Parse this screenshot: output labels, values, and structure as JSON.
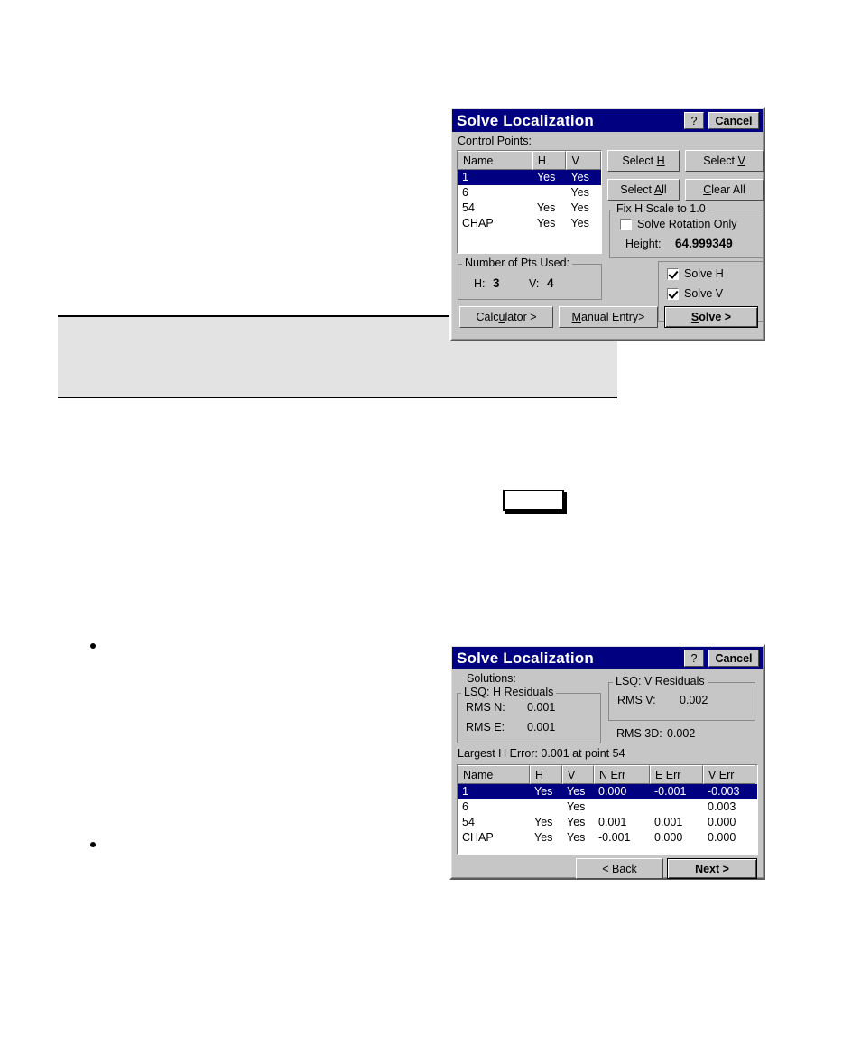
{
  "document": {
    "note_box": "",
    "empty_box": "",
    "bullets": [
      "",
      ""
    ]
  },
  "dialog_solve": {
    "title": "Solve Localization",
    "help_label": "?",
    "cancel_label": "Cancel",
    "control_points_label": "Control Points:",
    "table": {
      "columns": [
        "Name",
        "H",
        "V"
      ],
      "rows": [
        {
          "name": "1",
          "h": "Yes",
          "v": "Yes",
          "selected": true
        },
        {
          "name": "6",
          "h": "",
          "v": "Yes",
          "selected": false
        },
        {
          "name": "54",
          "h": "Yes",
          "v": "Yes",
          "selected": false
        },
        {
          "name": "CHAP",
          "h": "Yes",
          "v": "Yes",
          "selected": false
        }
      ]
    },
    "buttons": {
      "select_h": "Select H",
      "select_v": "Select V",
      "select_all": "Select All",
      "clear_all": "Clear All",
      "calculator": "Calculator >",
      "manual_entry": "Manual Entry>",
      "solve": "Solve >"
    },
    "fix_scale_group": {
      "label": "Fix H Scale to 1.0",
      "solve_rotation_only_label": "Solve Rotation Only",
      "solve_rotation_only_checked": false,
      "height_label": "Height:",
      "height_value": "64.999349"
    },
    "pts_used_group": {
      "label": "Number of Pts Used:",
      "h_label": "H:",
      "h_value": "3",
      "v_label": "V:",
      "v_value": "4"
    },
    "solve_options": {
      "solve_h_label": "Solve H",
      "solve_h_checked": true,
      "solve_v_label": "Solve V",
      "solve_v_checked": true
    }
  },
  "dialog_solutions": {
    "title": "Solve Localization",
    "help_label": "?",
    "cancel_label": "Cancel",
    "solutions_label": "Solutions:",
    "h_residuals_group": {
      "label": "LSQ: H Residuals",
      "rms_n_label": "RMS N:",
      "rms_n_value": "0.001",
      "rms_e_label": "RMS E:",
      "rms_e_value": "0.001"
    },
    "v_residuals_group": {
      "label": "LSQ: V Residuals",
      "rms_v_label": "RMS V:",
      "rms_v_value": "0.002"
    },
    "rms_3d_label": "RMS 3D:",
    "rms_3d_value": "0.002",
    "largest_h_error": "Largest H Error: 0.001 at point 54",
    "table": {
      "columns": [
        "Name",
        "H",
        "V",
        "N Err",
        "E Err",
        "V Err"
      ],
      "rows": [
        {
          "name": "1",
          "h": "Yes",
          "v": "Yes",
          "n_err": "0.000",
          "e_err": "-0.001",
          "v_err": "-0.003",
          "selected": true
        },
        {
          "name": "6",
          "h": "",
          "v": "Yes",
          "n_err": "",
          "e_err": "",
          "v_err": "0.003",
          "selected": false
        },
        {
          "name": "54",
          "h": "Yes",
          "v": "Yes",
          "n_err": "0.001",
          "e_err": "0.001",
          "v_err": "0.000",
          "selected": false
        },
        {
          "name": "CHAP",
          "h": "Yes",
          "v": "Yes",
          "n_err": "-0.001",
          "e_err": "0.000",
          "v_err": "0.000",
          "selected": false
        }
      ]
    },
    "buttons": {
      "back": "< Back",
      "next": "Next >"
    }
  },
  "colors": {
    "titlebar": "#000080",
    "dialog_face": "#c6c6c6",
    "selection": "#000080",
    "note_box": "#e3e3e3"
  }
}
